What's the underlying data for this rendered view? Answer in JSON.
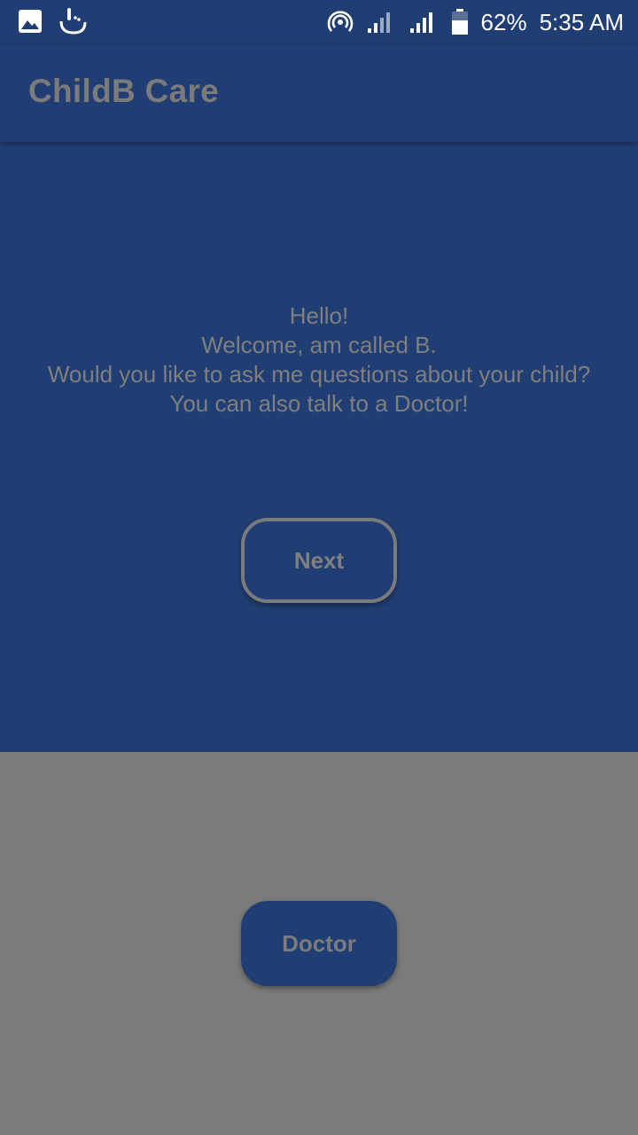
{
  "status_bar": {
    "battery_percent": "62%",
    "time": "5:35 AM",
    "left_icons": [
      "image-icon",
      "touchpal-icon"
    ],
    "right_icons": [
      "hotspot-icon",
      "signal-icon",
      "signal-icon",
      "battery-icon"
    ]
  },
  "app_bar": {
    "title": "ChildB Care"
  },
  "welcome": {
    "line1": "Hello!",
    "line2": "Welcome, am called B.",
    "line3": "Would you like to ask me questions about your child?",
    "line4": "You can also talk to a Doctor!"
  },
  "buttons": {
    "next_label": "Next",
    "doctor_label": "Doctor"
  },
  "colors": {
    "primary": "#203e73",
    "gray_panel": "#7b7b7b",
    "text_gray": "#7f7f7f"
  }
}
